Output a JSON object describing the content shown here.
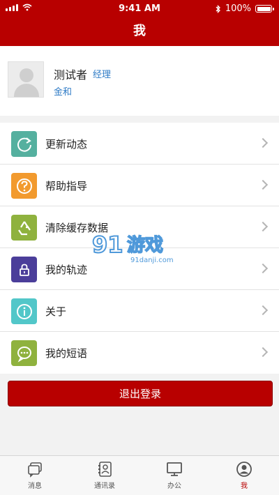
{
  "status_bar": {
    "time": "9:41 AM",
    "battery": "100%",
    "battery_level": 1.0
  },
  "nav": {
    "title": "我"
  },
  "profile": {
    "name": "测试者",
    "role": "经理",
    "company": "金和"
  },
  "menu": {
    "items": [
      {
        "label": "更新动态",
        "icon": "refresh-icon",
        "color": "#55b09f"
      },
      {
        "label": "帮助指导",
        "icon": "question-icon",
        "color": "#f29a2e"
      },
      {
        "label": "清除缓存数据",
        "icon": "recycle-icon",
        "color": "#8fb23e"
      },
      {
        "label": "我的轨迹",
        "icon": "lock-icon",
        "color": "#4b3e9a"
      },
      {
        "label": "关于",
        "icon": "info-icon",
        "color": "#52c7c9"
      },
      {
        "label": "我的短语",
        "icon": "chat-bubble-icon",
        "color": "#8fb23e"
      }
    ]
  },
  "logout": {
    "label": "退出登录"
  },
  "watermark": {
    "text": "91游戏",
    "sub": "91danji.com"
  },
  "tabbar": {
    "items": [
      {
        "label": "消息",
        "icon": "messages-icon"
      },
      {
        "label": "通讯录",
        "icon": "contacts-icon"
      },
      {
        "label": "办公",
        "icon": "monitor-icon"
      },
      {
        "label": "我",
        "icon": "user-icon"
      }
    ],
    "active_color": "#b80000"
  },
  "colors": {
    "brand": "#b80000",
    "link": "#2e7bc6"
  }
}
